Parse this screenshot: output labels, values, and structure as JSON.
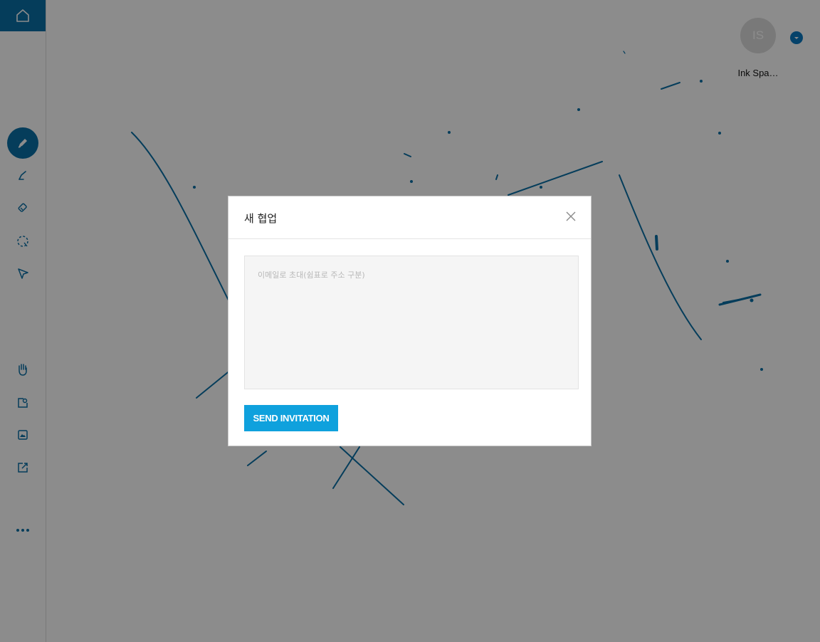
{
  "sidebar": {
    "tools": [
      {
        "icon": "pen-icon",
        "active": true
      },
      {
        "icon": "highlighter-icon",
        "active": false
      },
      {
        "icon": "eraser-icon",
        "active": false
      },
      {
        "icon": "lasso-select-icon",
        "active": false
      },
      {
        "icon": "pointer-icon",
        "active": false
      },
      {
        "icon": "hand-pan-icon",
        "active": false
      },
      {
        "icon": "image-frame-icon",
        "active": false
      },
      {
        "icon": "insert-image-icon",
        "active": false
      },
      {
        "icon": "share-export-icon",
        "active": false
      },
      {
        "icon": "more-icon",
        "active": false
      }
    ],
    "accent": "#0a6fa6"
  },
  "user": {
    "initials": "IS",
    "name": "Ink Spa…"
  },
  "ink_color": "#0a6fa6",
  "modal": {
    "title": "새 협업",
    "invite_placeholder": "이메일로 초대(쉼표로 주소 구분)",
    "send_label": "SEND INVITATION",
    "button_color": "#0fa1dd"
  }
}
